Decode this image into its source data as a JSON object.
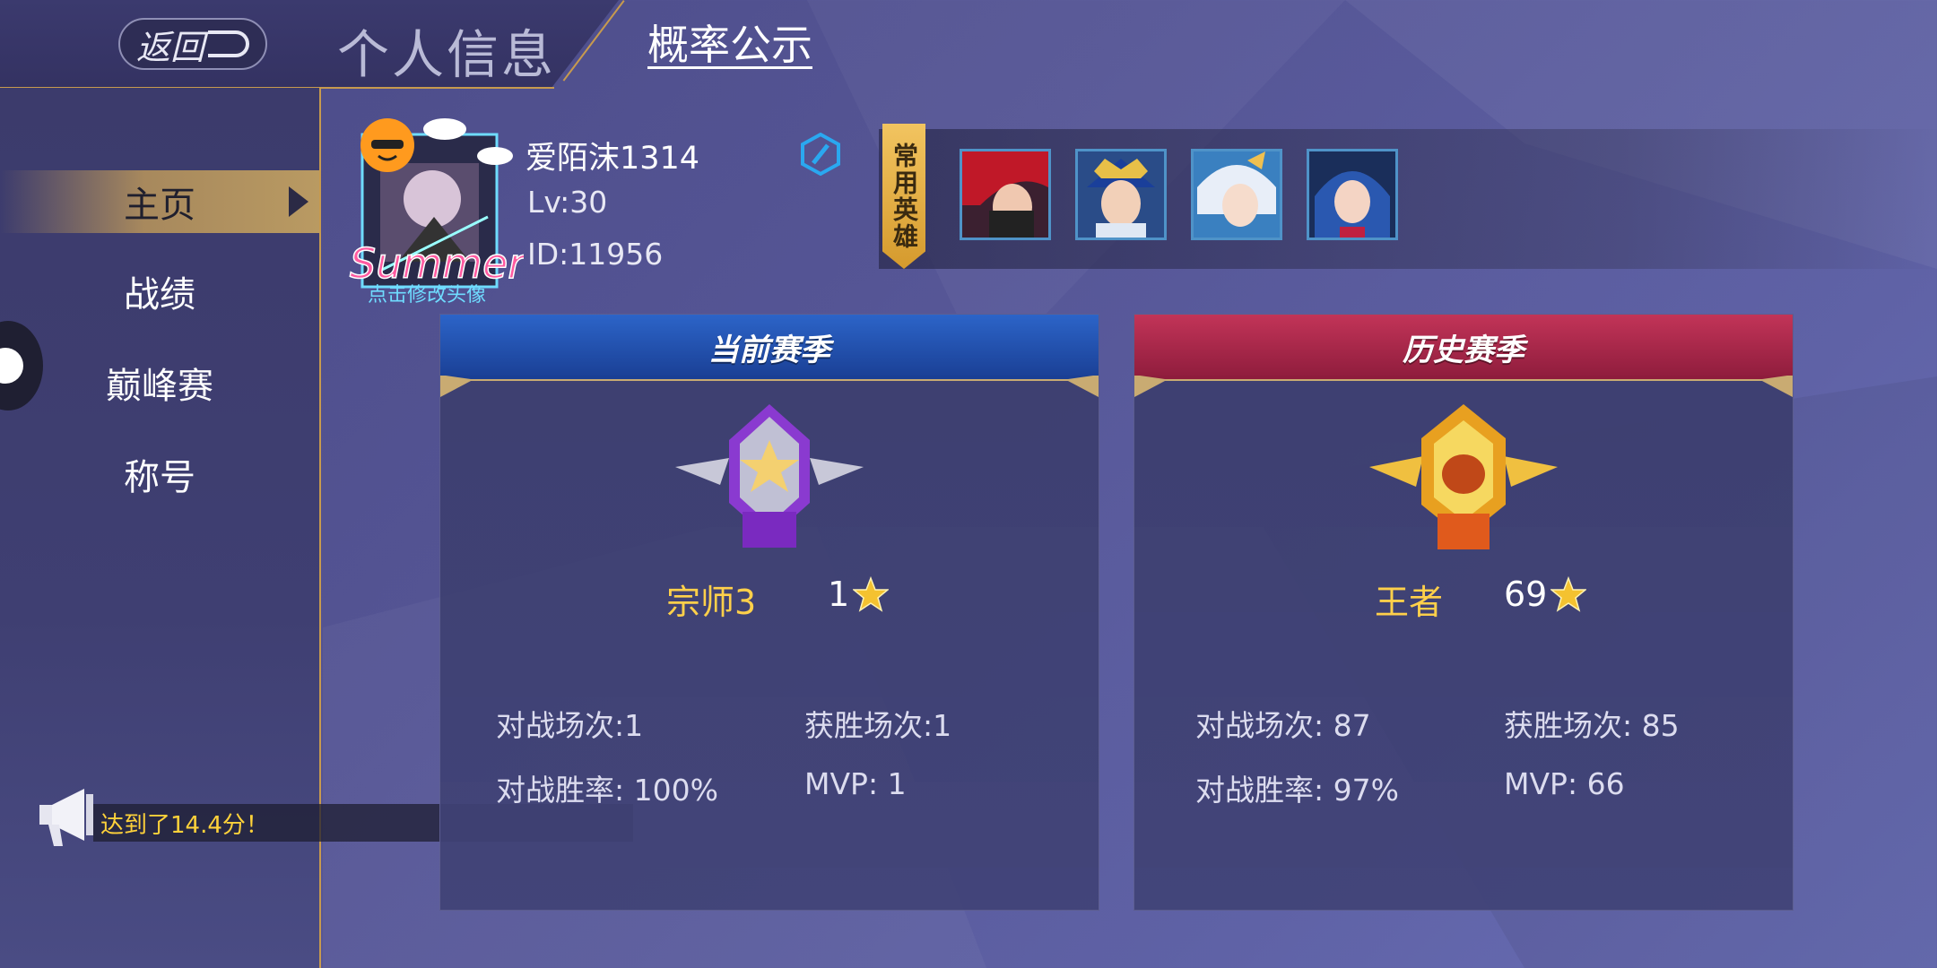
{
  "header": {
    "back_label": "返回",
    "title": "个人信息",
    "tab_probability": "概率公示"
  },
  "sidebar": {
    "items": [
      {
        "label": "主页",
        "active": true
      },
      {
        "label": "战绩",
        "active": false
      },
      {
        "label": "巅峰赛",
        "active": false
      },
      {
        "label": "称号",
        "active": false
      }
    ]
  },
  "announcement": {
    "text": "达到了14.4分！"
  },
  "profile": {
    "name": "爱陌沫1314",
    "level": "Lv:30",
    "id": "ID:11956",
    "avatar_caption": "点击修改头像",
    "avatar_text": "Summer"
  },
  "common_heroes": {
    "label": "常用英雄",
    "heroes": [
      "hero-portrait-red-hair",
      "hero-portrait-gold-crown",
      "hero-portrait-white-hair",
      "hero-portrait-blue-hair"
    ]
  },
  "seasons": {
    "current": {
      "title": "当前赛季",
      "rank": "宗师3",
      "stars": "1",
      "battles_label": "对战场次:",
      "battles": "1",
      "wins_label": "获胜场次:",
      "wins": "1",
      "winrate_label": "对战胜率:",
      "winrate": "100%",
      "mvp_label": "MVP:",
      "mvp": "1"
    },
    "history": {
      "title": "历史赛季",
      "rank": "王者",
      "stars": "69",
      "battles_label": "对战场次:",
      "battles": "87",
      "wins_label": "获胜场次:",
      "wins": "85",
      "winrate_label": "对战胜率:",
      "winrate": "97%",
      "mvp_label": "MVP:",
      "mvp": "66"
    }
  },
  "colors": {
    "accent_gold": "#c79a4e",
    "rank_text": "#ffd04a",
    "current_banner": "#1e4fb0",
    "history_banner": "#a8264a"
  }
}
